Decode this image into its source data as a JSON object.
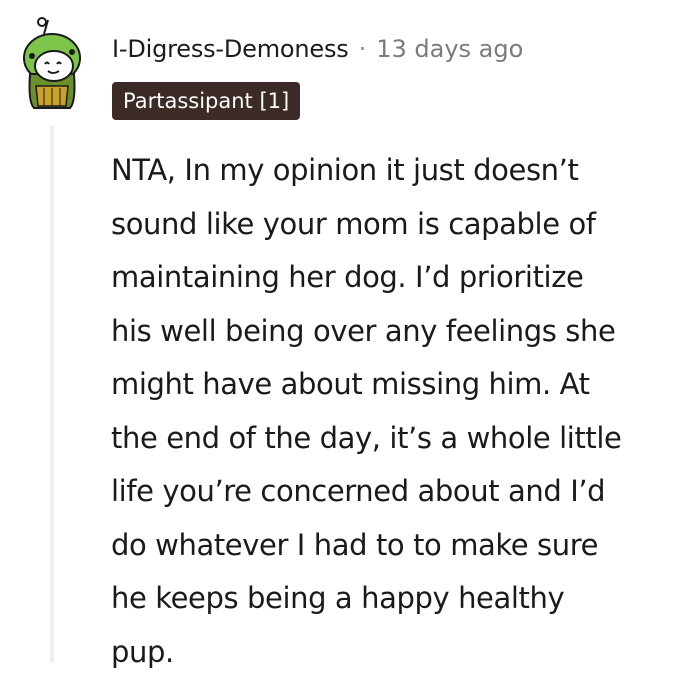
{
  "comment": {
    "author": "I-Digress-Demoness",
    "separator": "·",
    "timestamp": "13 days ago",
    "flair": "Partassipant [1]",
    "body_lines": [
      "NTA, In my opinion it just doesn’t",
      "sound like your mom is capable of",
      "maintaining her dog. I’d prioritize",
      "his well being over any feelings she",
      "might have about missing him. At",
      "the end of the day, it’s a whole little",
      "life you’re concerned about and I’d",
      "do whatever I had to to make sure",
      "he keeps being a happy healthy",
      "pup."
    ]
  },
  "avatar": {
    "icon": "snoo-avatar-icon",
    "colors": {
      "hat": "#7cc54a",
      "face": "#ffffff",
      "outline": "#1a1a1a",
      "body": "#6b8f2a",
      "trim": "#c9a227"
    }
  },
  "colors": {
    "flair_bg": "#3b2a26",
    "flair_text": "#ffffff",
    "thread_line": "#edeff1",
    "timestamp": "#787c7e"
  }
}
